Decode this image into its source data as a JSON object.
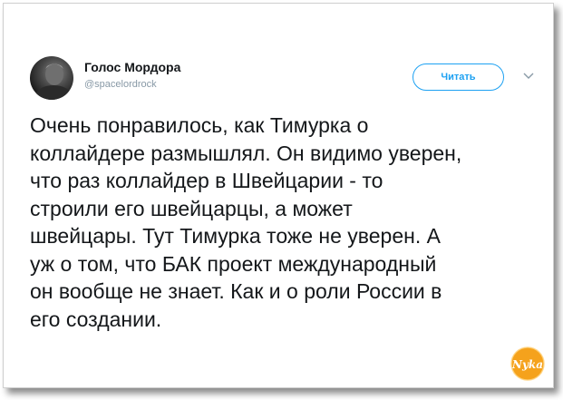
{
  "tweet": {
    "author_name": "Голос Мордора",
    "author_handle": "@spacelordrock",
    "follow_label": "Читать",
    "text_lines": [
      "Очень понравилось, как Тимурка о",
      "коллайдере размышлял. Он видимо уверен,",
      "что раз коллайдер в Швейцарии - то",
      "строили его швейцарцы, а может",
      "швейцары. Тут Тимурка тоже не уверен. А",
      "уж о том, что БАК проект международный",
      "он вообще не знает. Как и о роли России в",
      "его создании."
    ]
  },
  "watermark": {
    "text": "Nyka"
  },
  "colors": {
    "accent": "#1da1f2",
    "text": "#14171a",
    "muted": "#8899a6",
    "logo_orange": "#f5a21c"
  },
  "icons": {
    "avatar": "profile-photo",
    "caret": "chevron-down-icon",
    "logo": "watermark-logo"
  }
}
